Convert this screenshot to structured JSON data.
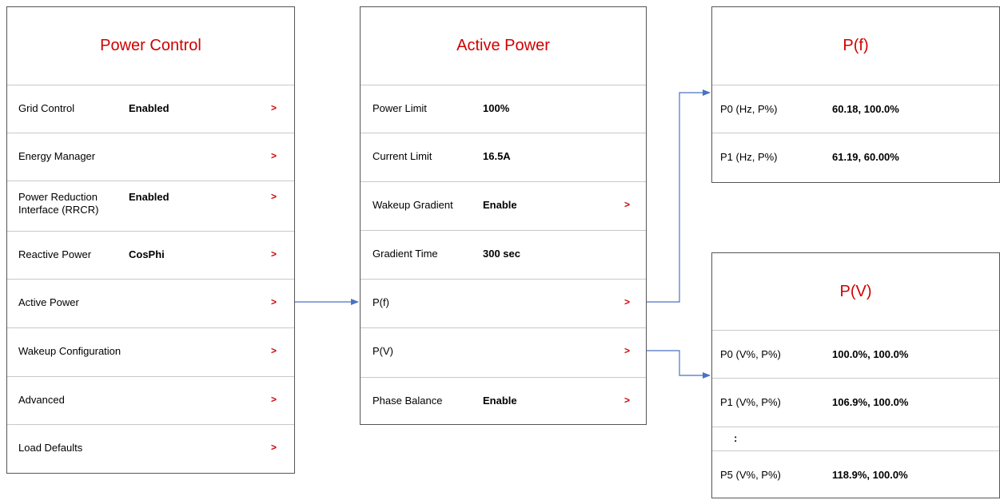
{
  "colors": {
    "title": "#d00000",
    "arrow": "#d00000",
    "connector": "#4a72c4",
    "border": "#555555"
  },
  "power_control": {
    "title": "Power Control",
    "rows": [
      {
        "label": "Grid Control",
        "value": "Enabled",
        "arrow": ">"
      },
      {
        "label": "Energy Manager",
        "value": "",
        "arrow": ">"
      },
      {
        "label": "Power Reduction\nInterface (RRCR)",
        "value": "Enabled",
        "arrow": ">"
      },
      {
        "label": "Reactive Power",
        "value": "CosPhi",
        "arrow": ">"
      },
      {
        "label": "Active Power",
        "value": "",
        "arrow": ">"
      },
      {
        "label": "Wakeup Configuration",
        "value": "",
        "arrow": ">"
      },
      {
        "label": "Advanced",
        "value": "",
        "arrow": ">"
      },
      {
        "label": "Load Defaults",
        "value": "",
        "arrow": ">"
      }
    ]
  },
  "active_power": {
    "title": "Active Power",
    "rows": [
      {
        "label": "Power Limit",
        "value": "100%",
        "arrow": ""
      },
      {
        "label": "Current Limit",
        "value": "16.5A",
        "arrow": ""
      },
      {
        "label": "Wakeup Gradient",
        "value": "Enable",
        "arrow": ">"
      },
      {
        "label": "Gradient Time",
        "value": "300 sec",
        "arrow": ""
      },
      {
        "label": "P(f)",
        "value": "",
        "arrow": ">"
      },
      {
        "label": "P(V)",
        "value": "",
        "arrow": ">"
      },
      {
        "label": "Phase Balance",
        "value": "Enable",
        "arrow": ">"
      }
    ]
  },
  "pf": {
    "title": "P(f)",
    "rows": [
      {
        "label": "P0 (Hz, P%)",
        "value": "60.18, 100.0%"
      },
      {
        "label": "P1 (Hz, P%)",
        "value": "61.19, 60.00%"
      }
    ]
  },
  "pv": {
    "title": "P(V)",
    "rows": [
      {
        "label": "P0 (V%, P%)",
        "value": "100.0%, 100.0%"
      },
      {
        "label": "P1 (V%, P%)",
        "value": "106.9%, 100.0%"
      },
      {
        "label": ":",
        "value": ""
      },
      {
        "label": "P5 (V%, P%)",
        "value": "118.9%, 100.0%"
      }
    ]
  }
}
